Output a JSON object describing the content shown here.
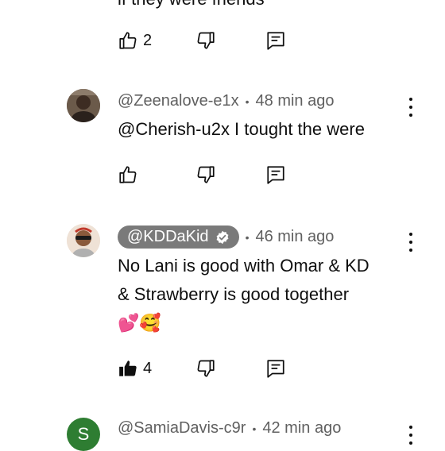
{
  "prev_comment": {
    "partial_text": "if they were friends",
    "like_count": "2"
  },
  "comments": [
    {
      "author": "@Zeenalove-e1x",
      "time": "48 min ago",
      "text": "@Cherish-u2x I tought the were",
      "like_count": ""
    },
    {
      "author": "@KDDaKid",
      "time": "46 min ago",
      "text_line1": "No Lani is good with Omar & KD",
      "text_line2": "& Strawberry is good together",
      "emojis": "💕🥰",
      "like_count": "4",
      "liked": true,
      "creator_pill_color": "#7a7a7a"
    },
    {
      "author": "@SamiaDavis-c9r",
      "time": "42 min ago",
      "avatar_letter": "S",
      "avatar_color": "#2e7d32"
    }
  ],
  "separator": "•"
}
